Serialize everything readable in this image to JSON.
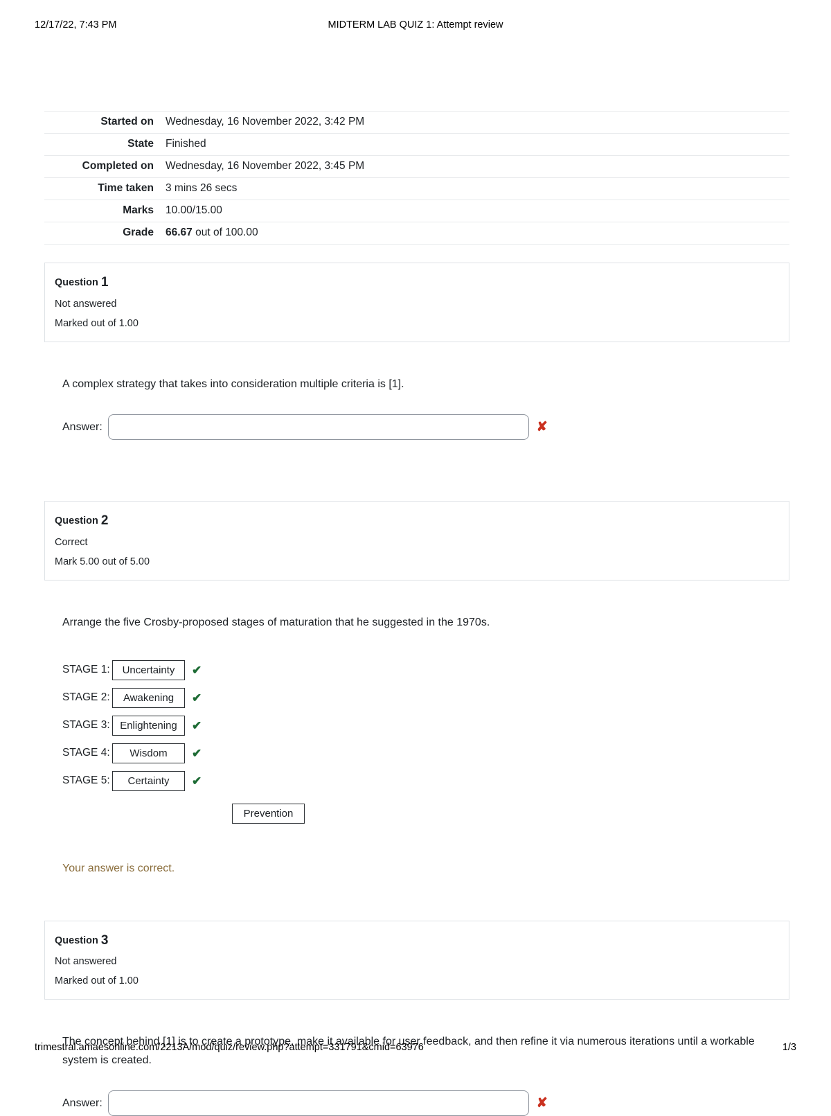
{
  "print_header": {
    "left": "12/17/22, 7:43 PM",
    "center": "MIDTERM LAB QUIZ 1: Attempt review"
  },
  "print_footer": {
    "url": "trimestral.amaesonline.com/2213A/mod/quiz/review.php?attempt=331791&cmid=63976",
    "page": "1/3"
  },
  "attempt_summary": {
    "rows": [
      {
        "label": "Started on",
        "value": "Wednesday, 16 November 2022, 3:42 PM"
      },
      {
        "label": "State",
        "value": "Finished"
      },
      {
        "label": "Completed on",
        "value": "Wednesday, 16 November 2022, 3:45 PM"
      },
      {
        "label": "Time taken",
        "value": "3 mins 26 secs"
      },
      {
        "label": "Marks",
        "value": "10.00/15.00"
      }
    ],
    "grade_row": {
      "label": "Grade",
      "value_bold": "66.67",
      "value_rest": " out of 100.00"
    }
  },
  "questions": [
    {
      "title_prefix": "Question",
      "number": "1",
      "state": "Not answered",
      "grade": "Marked out of 1.00",
      "text": "A complex strategy that takes into consideration multiple criteria is [1].",
      "answer_label": "Answer:",
      "answer_value": "",
      "answer_placeholder": "",
      "mark_icon": "✘",
      "mark_icon_name": "incorrect-icon"
    },
    {
      "title_prefix": "Question",
      "number": "2",
      "state": "Correct",
      "grade": "Mark 5.00 out of 5.00",
      "text": "Arrange the five Crosby-proposed stages of maturation that he suggested in the 1970s.",
      "stages": [
        {
          "label": "STAGE 1:",
          "value": "Uncertainty",
          "tick": "✔"
        },
        {
          "label": "STAGE 2:",
          "value": "Awakening",
          "tick": "✔"
        },
        {
          "label": "STAGE 3:",
          "value": "Enlightening",
          "tick": "✔"
        },
        {
          "label": "STAGE 4:",
          "value": "Wisdom",
          "tick": "✔"
        },
        {
          "label": "STAGE 5:",
          "value": "Certainty",
          "tick": "✔"
        }
      ],
      "spare_drags": [
        "Prevention"
      ],
      "feedback": "Your answer is correct."
    },
    {
      "title_prefix": "Question",
      "number": "3",
      "state": "Not answered",
      "grade": "Marked out of 1.00",
      "text": "The concept behind [1] is to create a prototype, make it available for user feedback, and then refine it via numerous iterations until a workable system is created.",
      "answer_label": "Answer:",
      "answer_value": "",
      "answer_placeholder": "",
      "mark_icon": "✘",
      "mark_icon_name": "incorrect-icon"
    }
  ],
  "colors": {
    "correct_green": "#1d6b34",
    "incorrect_red": "#ca3120",
    "feedback_brown": "#8a6d3b",
    "box_border": "#dee2e6"
  }
}
